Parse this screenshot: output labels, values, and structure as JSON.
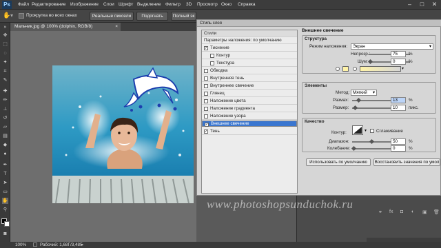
{
  "app": {
    "logo": "Ps"
  },
  "menu": [
    "Файл",
    "Редактирование",
    "Изображение",
    "Слои",
    "Шрифт",
    "Выделение",
    "Фильтр",
    "3D",
    "Просмотр",
    "Окно",
    "Справка"
  ],
  "options": {
    "scroll_all_label": "Прокрутка во всех окнах",
    "actual_pixels": "Реальные пиксели",
    "fit": "Подогнать",
    "full": "Полный эк"
  },
  "document": {
    "tab": "Мальчик.jpg @ 100% (dolphin, RGB/8)",
    "zoom": "100%",
    "status": "Рабочий: 1,68Г/3,48Г"
  },
  "dialog": {
    "title": "Стиль слоя",
    "list_header": "Стили",
    "items": [
      {
        "label": "Параметры наложения: по умолчанию",
        "checkbox": false,
        "checked": false,
        "indent": false
      },
      {
        "label": "Тиснение",
        "checkbox": true,
        "checked": true,
        "indent": false
      },
      {
        "label": "Контур",
        "checkbox": true,
        "checked": false,
        "indent": true
      },
      {
        "label": "Текстура",
        "checkbox": true,
        "checked": false,
        "indent": true
      },
      {
        "label": "Обводка",
        "checkbox": true,
        "checked": false,
        "indent": false
      },
      {
        "label": "Внутренняя тень",
        "checkbox": true,
        "checked": false,
        "indent": false
      },
      {
        "label": "Внутреннее свечение",
        "checkbox": true,
        "checked": false,
        "indent": false
      },
      {
        "label": "Глянец",
        "checkbox": true,
        "checked": false,
        "indent": false
      },
      {
        "label": "Наложение цвета",
        "checkbox": true,
        "checked": false,
        "indent": false
      },
      {
        "label": "Наложение градиента",
        "checkbox": true,
        "checked": false,
        "indent": false
      },
      {
        "label": "Наложение узора",
        "checkbox": true,
        "checked": false,
        "indent": false
      },
      {
        "label": "Внешнее свечение",
        "checkbox": true,
        "checked": true,
        "indent": false,
        "selected": true
      },
      {
        "label": "Тень",
        "checkbox": true,
        "checked": true,
        "indent": false
      }
    ],
    "section_title": "Внешнее свечение",
    "structure": {
      "title": "Структура",
      "blend_label": "Режим наложения:",
      "blend_value": "Экран",
      "opacity_label": "Непрозр.:",
      "opacity_value": "75",
      "opacity_fraction": 0.75,
      "noise_label": "Шум:",
      "noise_value": "0",
      "noise_fraction": 0.0,
      "unit": "%"
    },
    "elements": {
      "title": "Элементы",
      "method_label": "Метод:",
      "method_value": "Мягкий",
      "spread_label": "Размах:",
      "spread_value": "13",
      "spread_fraction": 0.13,
      "size_label": "Размер:",
      "size_value": "10",
      "size_unit": "пикс.",
      "size_fraction": 0.04,
      "unit": "%"
    },
    "quality": {
      "title": "Качество",
      "contour_label": "Контур:",
      "antialias_label": "Сглаживание",
      "range_label": "Диапазон:",
      "range_value": "50",
      "range_fraction": 0.5,
      "jitter_label": "Колебание:",
      "jitter_value": "0",
      "jitter_fraction": 0.0,
      "unit": "%"
    },
    "buttons": {
      "default": "Использовать по умолчанию",
      "reset": "Восстановить значения по умол"
    }
  },
  "watermark": "www.photoshopsunduchok.ru",
  "colors": {
    "glow": "#fff3a8",
    "selection": "#3a76d0"
  }
}
